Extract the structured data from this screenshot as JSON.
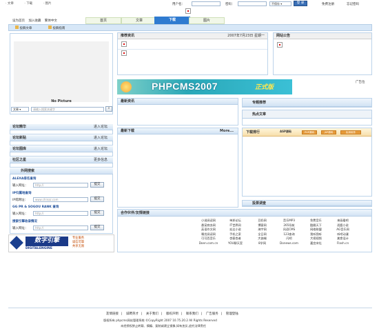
{
  "topbar": {
    "nav": [
      "文章",
      "下载",
      "图片"
    ],
    "username_label": "用户名：",
    "password_label": "密码：",
    "remember_value": "不保存",
    "login_label": "登 录",
    "register_label": "免费注册",
    "forgot_label": "忘记密码"
  },
  "quicklinks": [
    "设为首页",
    "加入收藏",
    "繁体中文"
  ],
  "tabs": [
    "首页",
    "文章",
    "下载",
    "图片"
  ],
  "subtabs": [
    "投稿文章",
    "投稿指南"
  ],
  "left": {
    "picture_caption": "No Picture",
    "search_select": "文章",
    "search_placeholder": "请输入搜索关键字",
    "sections": [
      {
        "title": "论坛精华",
        "action": "进入论坛"
      },
      {
        "title": "论坛新贴",
        "action": "进入论坛"
      },
      {
        "title": "论坛图库",
        "action": "进入论坛"
      },
      {
        "title": "社区之星",
        "action": "更多信息"
      }
    ],
    "ext_title": "外网搜索",
    "ext": [
      {
        "title": "ALEXA排名查询",
        "label": "输入网址：",
        "value": "http://",
        "button": "提交"
      },
      {
        "title": "IP归属地查询",
        "label": "IP或网址：",
        "value": "www.chinaz.com",
        "button": "提交"
      },
      {
        "title": "GG PR & SOGOU RANK 查询",
        "label": "输入网址：",
        "value": "http://",
        "button": "提交"
      },
      {
        "title": "搜索引擎收录情况",
        "label": "输入网址：",
        "value": "http://",
        "button": "提交"
      }
    ],
    "logo_text": "数字引擎",
    "logo_sub": "DIGITALENGINE",
    "logo_side": [
      "专业服务",
      "诚信可靠",
      "共享无限"
    ]
  },
  "center": {
    "recommend_title": "推荐资讯",
    "date": "2007年7月23日 星期一",
    "banner_text": "PHPCMS2007",
    "banner_tag": "正式版",
    "latest_news": "最新资讯",
    "latest_downloads": "最新下载",
    "more": "More...",
    "links_title": "合作伙伴/友情链接",
    "links": [
      [
        "小说阅读网",
        "单邦论坛",
        "豆奶网",
        "音乐MP3",
        "免费音乐",
        "来画看吧"
      ],
      [
        "悬宠商务网",
        "IT世界网",
        "博客网",
        "265导航",
        "酷圈天下",
        "逐鹿小说"
      ],
      [
        "英语作文网",
        "宏达小说",
        "海宇网",
        "风语CMS",
        "网络联盟",
        "AG音乐网"
      ],
      [
        "噢优阅读网",
        "手机之家",
        "全日网",
        "123查询",
        "我听我听",
        "听吧动漫"
      ],
      [
        "可可西音乐",
        "杏客杏者",
        "大伽端",
        "闪吧",
        "大视视频",
        "美食设计"
      ],
      [
        "Doen.com.cn",
        "YOU聊天室",
        "8学网",
        "Donews.com",
        "嘉宜宋社",
        "Flash.cn"
      ]
    ]
  },
  "right": {
    "notice_title": "网站公告",
    "ad_label": "广告位",
    "special_title": "专题推荐",
    "hot_title": "热点文章",
    "rank_title": "下载排行",
    "rank_tabs": [
      "ASP源码",
      "PHP源码",
      "JSP源码",
      "实用软件"
    ],
    "survey_title": "投票调查"
  },
  "footer": {
    "links": [
      "友情链接",
      "诚聘英才",
      "关于我们",
      "版权声明",
      "联系我们",
      "广告服务",
      "管理登陆"
    ],
    "copyright": "版权所有 phpcms网站管理系统 ©CopyRight 2007 10.75.20.2 All Rights Reserved",
    "notice": "未经授权禁止转载、摘编、复制或建立镜像,如有违反,追究法律责任"
  },
  "colors": {
    "accent": "#2f7bd0",
    "border": "#bcd3ea",
    "orange": "#e79b3a"
  }
}
